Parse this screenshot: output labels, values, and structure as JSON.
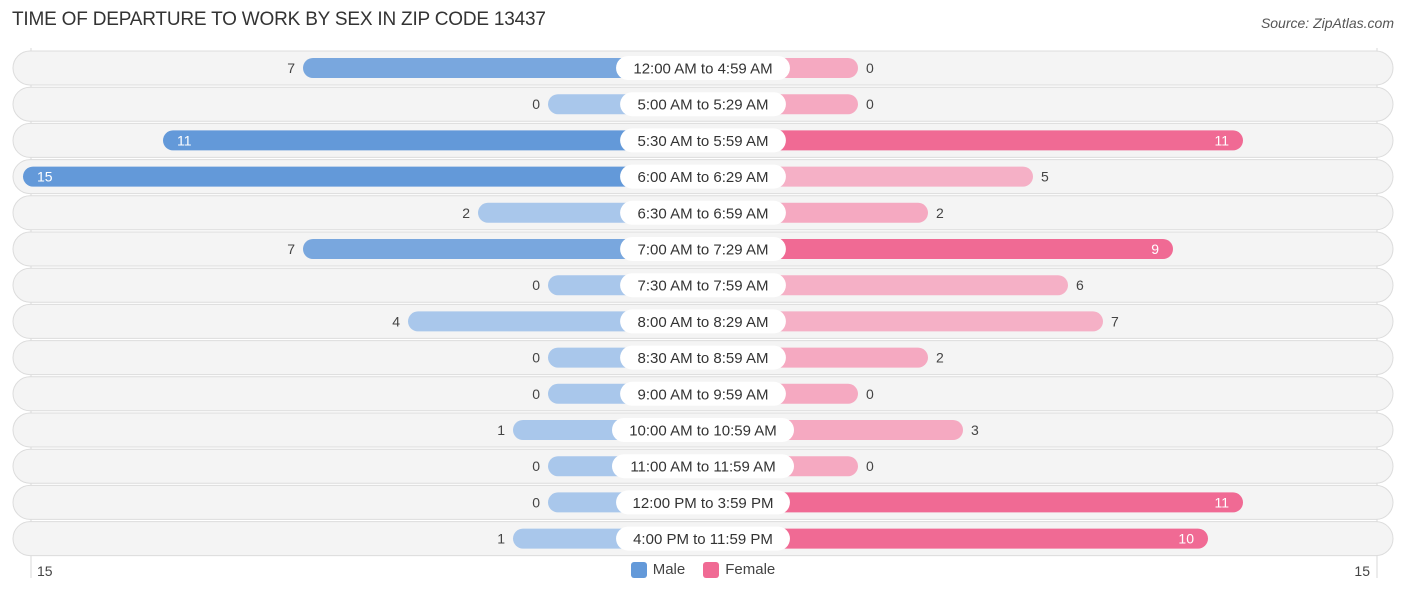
{
  "chart_data": {
    "type": "bar",
    "orientation": "horizontal-diverging",
    "title": "TIME OF DEPARTURE TO WORK BY SEX IN ZIP CODE 13437",
    "source": "Source: ZipAtlas.com",
    "categories": [
      "12:00 AM to 4:59 AM",
      "5:00 AM to 5:29 AM",
      "5:30 AM to 5:59 AM",
      "6:00 AM to 6:29 AM",
      "6:30 AM to 6:59 AM",
      "7:00 AM to 7:29 AM",
      "7:30 AM to 7:59 AM",
      "8:00 AM to 8:29 AM",
      "8:30 AM to 8:59 AM",
      "9:00 AM to 9:59 AM",
      "10:00 AM to 10:59 AM",
      "11:00 AM to 11:59 AM",
      "12:00 PM to 3:59 PM",
      "4:00 PM to 11:59 PM"
    ],
    "series": [
      {
        "name": "Male",
        "values": [
          7,
          0,
          11,
          15,
          2,
          7,
          0,
          4,
          0,
          0,
          1,
          0,
          0,
          1
        ]
      },
      {
        "name": "Female",
        "values": [
          0,
          0,
          11,
          5,
          2,
          9,
          6,
          7,
          2,
          0,
          3,
          0,
          11,
          10
        ]
      }
    ],
    "axis": {
      "left_label": "15",
      "right_label": "15",
      "max": 15
    },
    "legend": {
      "position": "bottom-center",
      "entries": [
        "Male",
        "Female"
      ]
    },
    "colors": {
      "male_strong": "#6399d9",
      "male_light": "#a9c7eb",
      "female_strong": "#f06a94",
      "female_light": "#f5a9c1"
    }
  }
}
